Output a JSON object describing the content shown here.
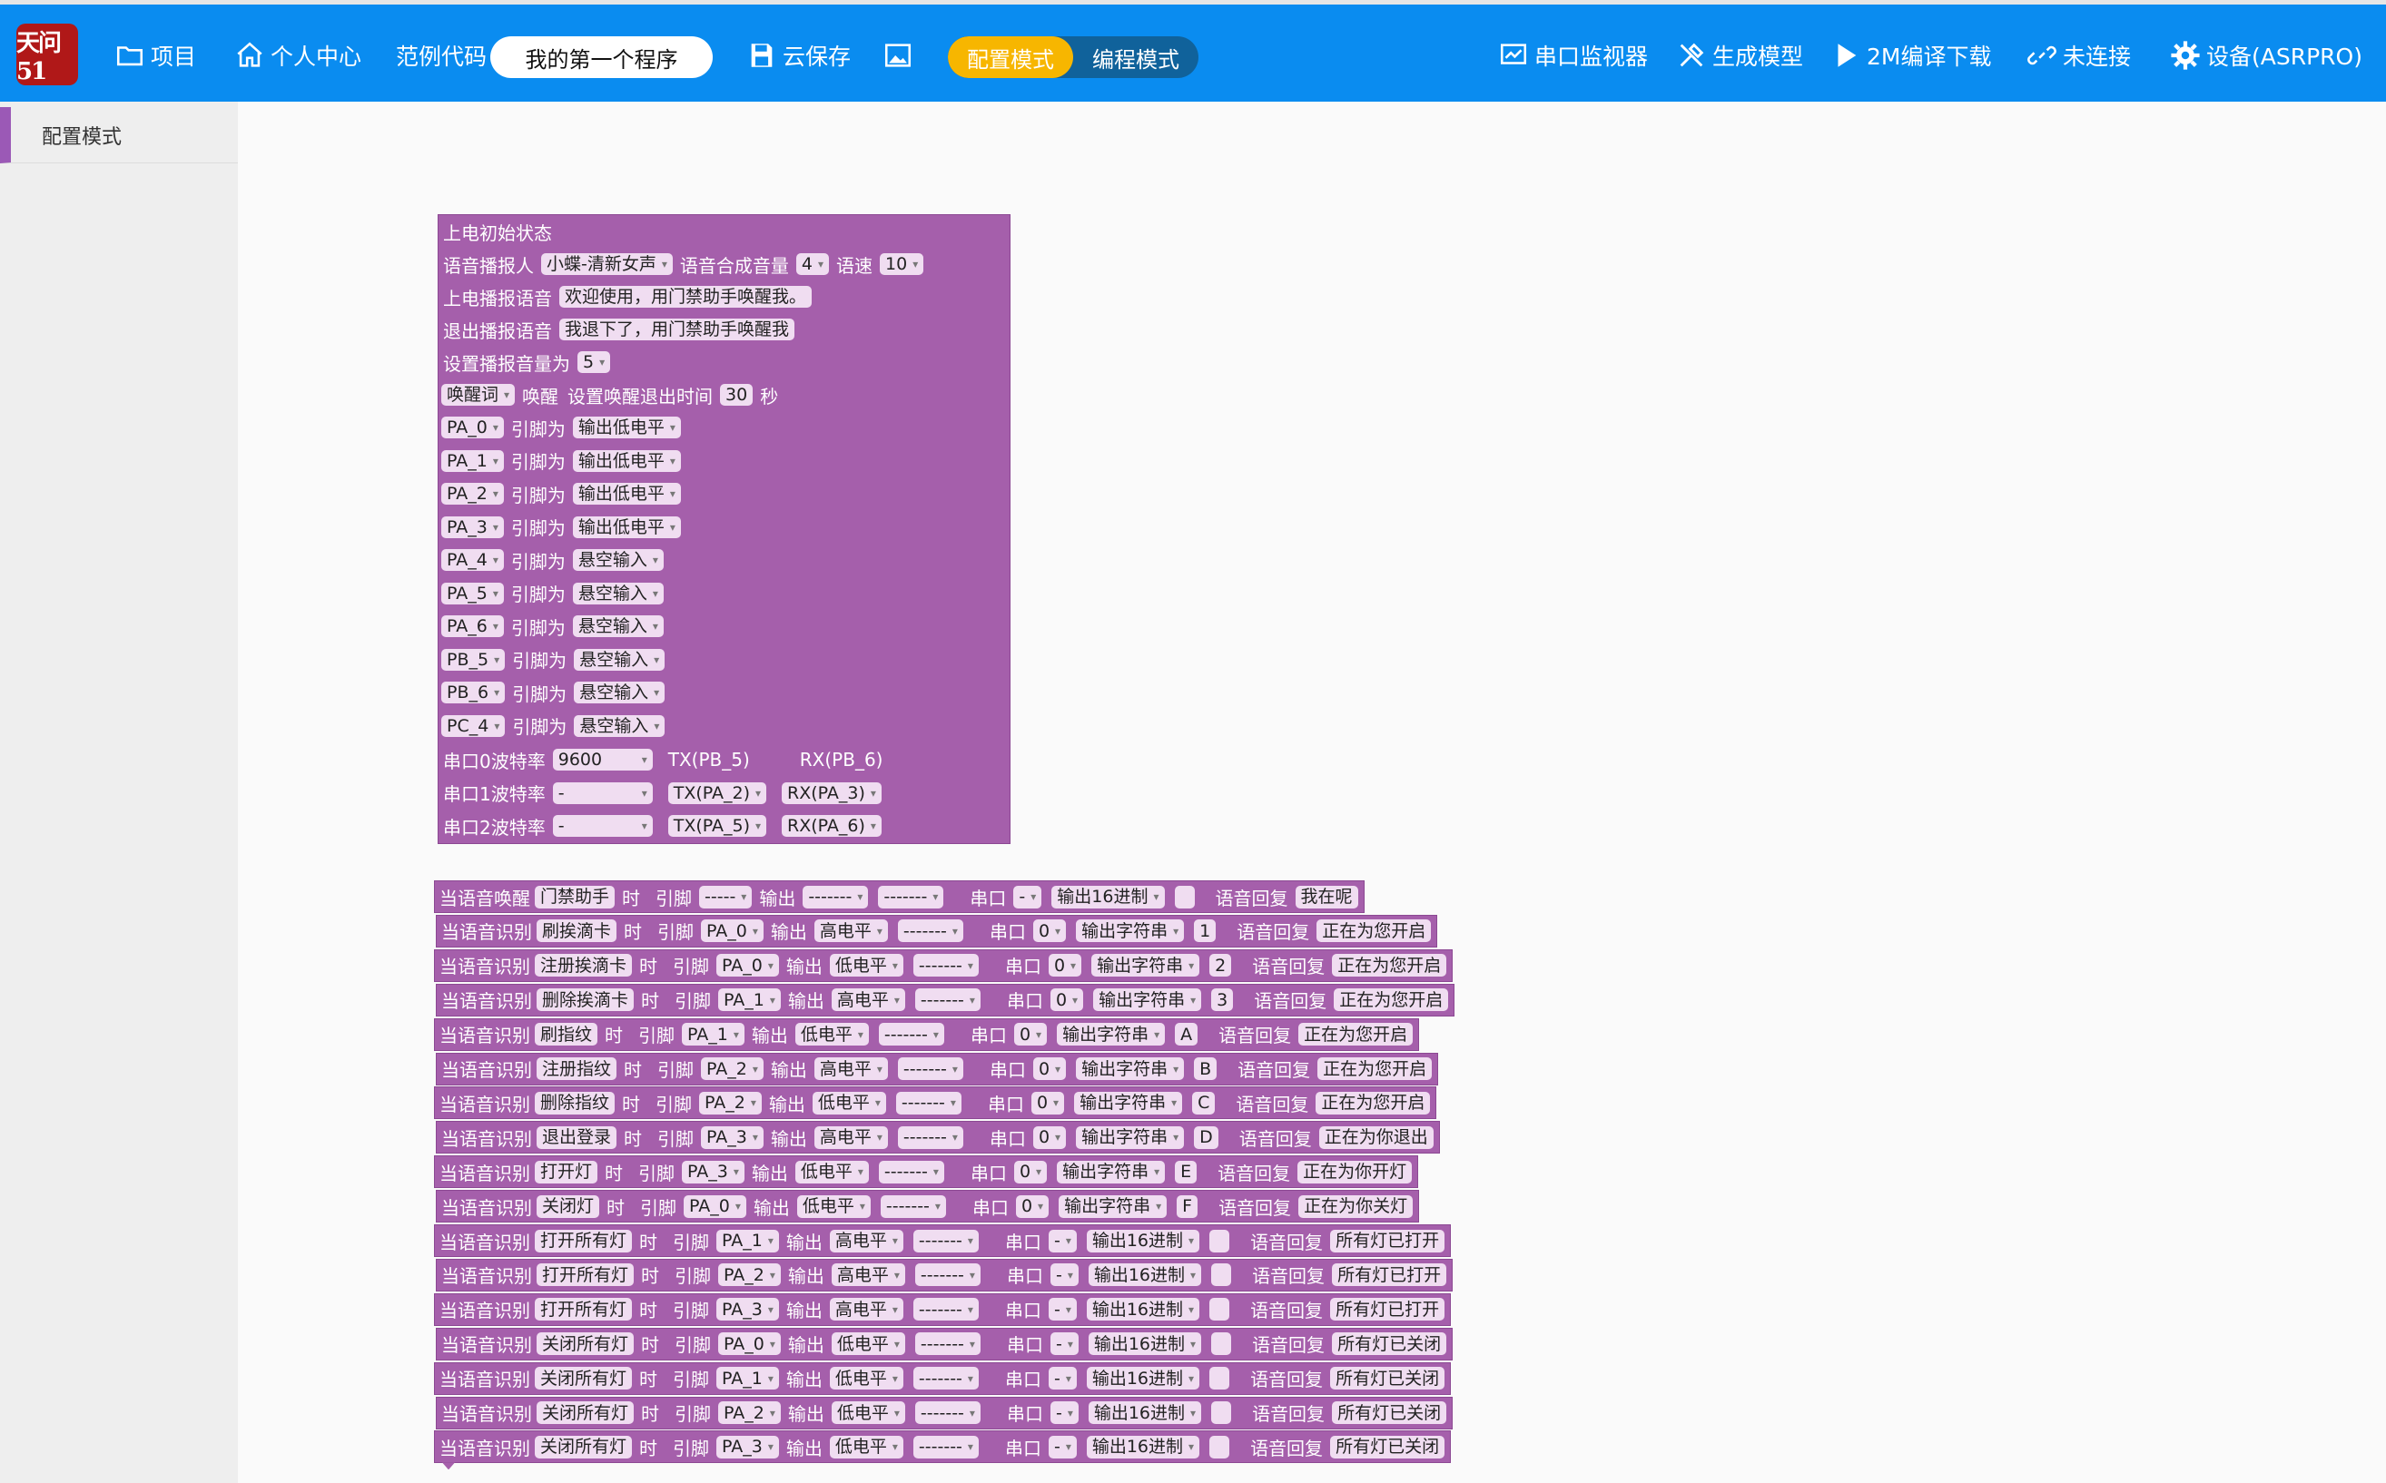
{
  "header": {
    "logo_text": "天问51",
    "items": [
      {
        "label": "项目",
        "icon": "folder-icon"
      },
      {
        "label": "个人中心",
        "icon": "home-icon"
      },
      {
        "label": "范例代码"
      },
      {
        "label": "云保存",
        "icon": "save-icon"
      },
      {
        "label": "",
        "icon": "image-icon"
      },
      {
        "label": "串口监视器",
        "icon": "monitor-icon"
      },
      {
        "label": "生成模型",
        "icon": "tools-icon"
      },
      {
        "label": "2M编译下载",
        "icon": "play-icon"
      },
      {
        "label": "未连接",
        "icon": "link-icon"
      },
      {
        "label": "设备(ASRPRO)",
        "icon": "gear-icon"
      }
    ],
    "program_name": "我的第一个程序",
    "mode_config": "配置模式",
    "mode_code": "编程模式"
  },
  "sidebar": {
    "items": [
      {
        "label": "配置模式"
      }
    ]
  },
  "config_block": {
    "title": "上电初始状态",
    "speaker_label": "语音播报人",
    "speaker_value": "小蝶-清新女声",
    "volume_label": "语音合成音量",
    "volume_value": "4",
    "speed_label": "语速",
    "speed_value": "10",
    "boot_label": "上电播报语音",
    "boot_value": "欢迎使用，用门禁助手唤醒我。",
    "exit_label": "退出播报语音",
    "exit_value": "我退下了，用门禁助手唤醒我",
    "vol2_label": "设置播报音量为",
    "vol2_value": "5",
    "wake_select": "唤醒词",
    "wake_label": "唤醒",
    "wake_timeout_label": "设置唤醒退出时间",
    "wake_timeout_value": "30",
    "wake_timeout_unit": "秒",
    "pin_label": "引脚为",
    "pins": [
      {
        "pin": "PA_0",
        "mode": "输出低电平"
      },
      {
        "pin": "PA_1",
        "mode": "输出低电平"
      },
      {
        "pin": "PA_2",
        "mode": "输出低电平"
      },
      {
        "pin": "PA_3",
        "mode": "输出低电平"
      },
      {
        "pin": "PA_4",
        "mode": "悬空输入"
      },
      {
        "pin": "PA_5",
        "mode": "悬空输入"
      },
      {
        "pin": "PA_6",
        "mode": "悬空输入"
      },
      {
        "pin": "PB_5",
        "mode": "悬空输入"
      },
      {
        "pin": "PB_6",
        "mode": "悬空输入"
      },
      {
        "pin": "PC_4",
        "mode": "悬空输入"
      }
    ],
    "serial": [
      {
        "label": "串口0波特率",
        "baud": "9600",
        "tx": "TX(PB_5)",
        "rx": "RX(PB_6)",
        "txrx_dd": false
      },
      {
        "label": "串口1波特率",
        "baud": "-",
        "tx": "TX(PA_2)",
        "rx": "RX(PA_3)",
        "txrx_dd": true
      },
      {
        "label": "串口2波特率",
        "baud": "-",
        "tx": "TX(PA_5)",
        "rx": "RX(PA_6)",
        "txrx_dd": true
      }
    ]
  },
  "labels": {
    "when": "当语音识别",
    "when_wake": "当语音唤醒",
    "time": "时",
    "pin": "引脚",
    "output": "输出",
    "uart": "串口",
    "reply": "语音回复"
  },
  "rules": [
    {
      "trigger": "当语音唤醒",
      "word": "门禁助手",
      "pin": "-----",
      "level": "-------",
      "extra": "-------",
      "port": "-",
      "fmt": "输出16进制",
      "data": "",
      "reply": "我在呢"
    },
    {
      "trigger": "当语音识别",
      "word": "刷挨滴卡",
      "pin": "PA_0",
      "level": "高电平",
      "extra": "-------",
      "port": "0",
      "fmt": "输出字符串",
      "data": "1",
      "reply": "正在为您开启"
    },
    {
      "trigger": "当语音识别",
      "word": "注册挨滴卡",
      "pin": "PA_0",
      "level": "低电平",
      "extra": "-------",
      "port": "0",
      "fmt": "输出字符串",
      "data": "2",
      "reply": "正在为您开启"
    },
    {
      "trigger": "当语音识别",
      "word": "删除挨滴卡",
      "pin": "PA_1",
      "level": "高电平",
      "extra": "-------",
      "port": "0",
      "fmt": "输出字符串",
      "data": "3",
      "reply": "正在为您开启"
    },
    {
      "trigger": "当语音识别",
      "word": "刷指纹",
      "pin": "PA_1",
      "level": "低电平",
      "extra": "-------",
      "port": "0",
      "fmt": "输出字符串",
      "data": "A",
      "reply": "正在为您开启"
    },
    {
      "trigger": "当语音识别",
      "word": "注册指纹",
      "pin": "PA_2",
      "level": "高电平",
      "extra": "-------",
      "port": "0",
      "fmt": "输出字符串",
      "data": "B",
      "reply": "正在为您开启"
    },
    {
      "trigger": "当语音识别",
      "word": "删除指纹",
      "pin": "PA_2",
      "level": "低电平",
      "extra": "-------",
      "port": "0",
      "fmt": "输出字符串",
      "data": "C",
      "reply": "正在为您开启"
    },
    {
      "trigger": "当语音识别",
      "word": "退出登录",
      "pin": "PA_3",
      "level": "高电平",
      "extra": "-------",
      "port": "0",
      "fmt": "输出字符串",
      "data": "D",
      "reply": "正在为你退出"
    },
    {
      "trigger": "当语音识别",
      "word": "打开灯",
      "pin": "PA_3",
      "level": "低电平",
      "extra": "-------",
      "port": "0",
      "fmt": "输出字符串",
      "data": "E",
      "reply": "正在为你开灯"
    },
    {
      "trigger": "当语音识别",
      "word": "关闭灯",
      "pin": "PA_0",
      "level": "低电平",
      "extra": "-------",
      "port": "0",
      "fmt": "输出字符串",
      "data": "F",
      "reply": "正在为你关灯"
    },
    {
      "trigger": "当语音识别",
      "word": "打开所有灯",
      "pin": "PA_1",
      "level": "高电平",
      "extra": "-------",
      "port": "-",
      "fmt": "输出16进制",
      "data": "",
      "reply": "所有灯已打开"
    },
    {
      "trigger": "当语音识别",
      "word": "打开所有灯",
      "pin": "PA_2",
      "level": "高电平",
      "extra": "-------",
      "port": "-",
      "fmt": "输出16进制",
      "data": "",
      "reply": "所有灯已打开"
    },
    {
      "trigger": "当语音识别",
      "word": "打开所有灯",
      "pin": "PA_3",
      "level": "高电平",
      "extra": "-------",
      "port": "-",
      "fmt": "输出16进制",
      "data": "",
      "reply": "所有灯已打开"
    },
    {
      "trigger": "当语音识别",
      "word": "关闭所有灯",
      "pin": "PA_0",
      "level": "低电平",
      "extra": "-------",
      "port": "-",
      "fmt": "输出16进制",
      "data": "",
      "reply": "所有灯已关闭"
    },
    {
      "trigger": "当语音识别",
      "word": "关闭所有灯",
      "pin": "PA_1",
      "level": "低电平",
      "extra": "-------",
      "port": "-",
      "fmt": "输出16进制",
      "data": "",
      "reply": "所有灯已关闭"
    },
    {
      "trigger": "当语音识别",
      "word": "关闭所有灯",
      "pin": "PA_2",
      "level": "低电平",
      "extra": "-------",
      "port": "-",
      "fmt": "输出16进制",
      "data": "",
      "reply": "所有灯已关闭"
    },
    {
      "trigger": "当语音识别",
      "word": "关闭所有灯",
      "pin": "PA_3",
      "level": "低电平",
      "extra": "-------",
      "port": "-",
      "fmt": "输出16进制",
      "data": "",
      "reply": "所有灯已关闭"
    }
  ],
  "colors": {
    "header_bg": "#0a8cf0",
    "block_bg": "#a55fab",
    "active_mode": "#f7b600",
    "field_bg": "#f0ddf1"
  }
}
